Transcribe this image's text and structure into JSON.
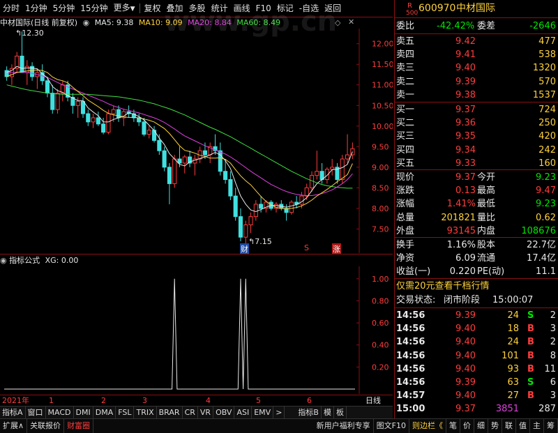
{
  "toolbar": {
    "items": [
      "分时",
      "1分钟",
      "5分钟",
      "15分钟",
      "更多",
      "复权",
      "叠加",
      "多股",
      "统计",
      "画线",
      "F10",
      "标记",
      "-自选",
      "返回"
    ]
  },
  "chart_header": {
    "title": "中材国际(日线 前复权)",
    "ma5": "MA5: 9.38",
    "ma10": "MA10: 9.09",
    "ma20": "MA20: 8.84",
    "ma60": "MA60: 8.49",
    "watermark": "www.gp.cn",
    "high_label": "12.30",
    "low_label": "7.15",
    "mark_cai": "财",
    "mark_s": "S",
    "mark_zhang": "涨",
    "colors": {
      "ma5": "#e8e8e8",
      "ma10": "#ffd23c",
      "ma20": "#e040e0",
      "ma60": "#40e040",
      "up": "#ff3c3c",
      "down": "#40e0e0"
    }
  },
  "chart_data": [
    {
      "type": "candlestick",
      "y_ticks": [
        "12.00",
        "11.50",
        "11.00",
        "10.50",
        "10.00",
        "9.50",
        "9.00",
        "8.50",
        "8.00",
        "7.50"
      ],
      "ylim": [
        7.15,
        12.3
      ],
      "candles": [
        [
          11.35,
          11.45,
          11.1,
          11.2
        ],
        [
          11.2,
          11.5,
          11.0,
          11.4
        ],
        [
          11.4,
          11.8,
          11.3,
          11.7
        ],
        [
          11.7,
          12.3,
          11.5,
          11.3
        ],
        [
          11.3,
          11.6,
          11.0,
          11.45
        ],
        [
          11.45,
          11.55,
          11.1,
          11.2
        ],
        [
          11.2,
          11.4,
          10.9,
          11.3
        ],
        [
          11.3,
          11.5,
          11.0,
          11.1
        ],
        [
          11.1,
          11.2,
          10.7,
          10.8
        ],
        [
          10.8,
          11.0,
          10.3,
          10.4
        ],
        [
          10.4,
          10.9,
          10.3,
          10.8
        ],
        [
          10.8,
          11.1,
          10.6,
          11.0
        ],
        [
          11.0,
          11.1,
          10.6,
          10.7
        ],
        [
          10.7,
          10.8,
          10.3,
          10.5
        ],
        [
          10.5,
          10.7,
          10.2,
          10.6
        ],
        [
          10.6,
          10.7,
          10.2,
          10.3
        ],
        [
          10.3,
          10.4,
          10.0,
          10.1
        ],
        [
          10.1,
          10.3,
          9.95,
          10.2
        ],
        [
          10.2,
          10.35,
          10.0,
          10.05
        ],
        [
          10.05,
          10.2,
          9.8,
          9.85
        ],
        [
          9.85,
          10.4,
          9.8,
          10.3
        ],
        [
          10.3,
          10.5,
          10.1,
          10.4
        ],
        [
          10.4,
          10.5,
          10.1,
          10.2
        ],
        [
          10.2,
          10.4,
          10.0,
          10.35
        ],
        [
          10.35,
          10.5,
          10.2,
          10.3
        ],
        [
          10.3,
          10.4,
          10.1,
          10.2
        ],
        [
          10.2,
          10.3,
          10.0,
          10.1
        ],
        [
          10.1,
          10.2,
          9.75,
          9.8
        ],
        [
          9.8,
          10.0,
          9.7,
          9.9
        ],
        [
          9.9,
          10.0,
          9.6,
          9.65
        ],
        [
          9.65,
          9.8,
          9.3,
          9.4
        ],
        [
          9.4,
          9.5,
          8.9,
          9.0
        ],
        [
          9.0,
          9.1,
          8.1,
          8.6
        ],
        [
          8.6,
          9.3,
          8.5,
          9.2
        ],
        [
          9.2,
          9.5,
          9.0,
          9.1
        ],
        [
          9.1,
          9.3,
          8.85,
          9.25
        ],
        [
          9.25,
          9.4,
          9.0,
          9.1
        ],
        [
          9.1,
          9.3,
          8.8,
          9.2
        ],
        [
          9.2,
          9.5,
          9.1,
          9.4
        ],
        [
          9.4,
          9.6,
          9.2,
          9.3
        ],
        [
          9.3,
          9.6,
          9.1,
          9.5
        ],
        [
          9.5,
          9.8,
          9.3,
          9.4
        ],
        [
          9.4,
          9.6,
          8.8,
          8.9
        ],
        [
          8.9,
          9.2,
          8.6,
          8.7
        ],
        [
          8.7,
          8.9,
          8.2,
          8.3
        ],
        [
          8.3,
          8.5,
          7.7,
          7.8
        ],
        [
          7.8,
          8.0,
          7.2,
          7.3
        ],
        [
          7.3,
          7.7,
          7.15,
          7.6
        ],
        [
          7.6,
          7.9,
          7.4,
          7.8
        ],
        [
          7.8,
          8.2,
          7.7,
          8.1
        ],
        [
          8.1,
          8.3,
          7.9,
          8.0
        ],
        [
          8.0,
          8.2,
          7.9,
          8.15
        ],
        [
          8.15,
          8.2,
          7.95,
          8.0
        ],
        [
          8.0,
          8.15,
          7.9,
          8.1
        ],
        [
          8.1,
          8.2,
          7.95,
          8.0
        ],
        [
          8.0,
          8.1,
          7.7,
          7.9
        ],
        [
          7.9,
          8.2,
          7.85,
          8.15
        ],
        [
          8.15,
          8.3,
          8.0,
          8.1
        ],
        [
          8.1,
          8.4,
          8.0,
          8.3
        ],
        [
          8.3,
          8.6,
          8.2,
          8.5
        ],
        [
          8.5,
          8.9,
          8.4,
          8.8
        ],
        [
          8.8,
          9.4,
          8.7,
          8.9
        ],
        [
          8.9,
          9.1,
          8.6,
          8.7
        ],
        [
          8.7,
          9.0,
          8.6,
          8.95
        ],
        [
          8.95,
          9.2,
          8.8,
          9.0
        ],
        [
          9.0,
          9.1,
          8.6,
          8.7
        ],
        [
          8.7,
          9.3,
          8.6,
          9.2
        ],
        [
          9.2,
          9.8,
          9.1,
          9.3
        ],
        [
          9.3,
          9.6,
          9.2,
          9.45
        ]
      ],
      "ma5": [
        11.3,
        11.35,
        11.45,
        11.4,
        11.41,
        11.41,
        11.39,
        11.27,
        11.17,
        10.96,
        10.86,
        10.82,
        10.74,
        10.68,
        10.62,
        10.62,
        10.44,
        10.34,
        10.25,
        10.1,
        10.1,
        10.16,
        10.2,
        10.24,
        10.32,
        10.29,
        10.23,
        10.15,
        10.02,
        9.89,
        9.71,
        9.55,
        9.33,
        9.2,
        9.07,
        9.03,
        9.13,
        9.17,
        9.21,
        9.25,
        9.3,
        9.36,
        9.3,
        9.16,
        8.97,
        8.62,
        8.3,
        8.1,
        7.96,
        7.92,
        7.97,
        8.03,
        8.07,
        8.07,
        8.05,
        8.03,
        8.06,
        8.09,
        8.16,
        8.26,
        8.43,
        8.6,
        8.7,
        8.8,
        8.94,
        8.95,
        8.99,
        9.07,
        9.38
      ],
      "ma10": [
        11.2,
        11.25,
        11.3,
        11.32,
        11.34,
        11.35,
        11.36,
        11.35,
        11.3,
        11.19,
        11.13,
        11.1,
        11.05,
        10.94,
        10.84,
        10.74,
        10.63,
        10.55,
        10.47,
        10.38,
        10.31,
        10.27,
        10.25,
        10.22,
        10.21,
        10.21,
        10.2,
        10.17,
        10.14,
        10.1,
        10.02,
        9.94,
        9.82,
        9.67,
        9.52,
        9.41,
        9.38,
        9.34,
        9.29,
        9.26,
        9.22,
        9.22,
        9.23,
        9.19,
        9.1,
        8.94,
        8.79,
        8.67,
        8.57,
        8.43,
        8.29,
        8.17,
        8.09,
        8.02,
        8.0,
        7.99,
        8.0,
        8.02,
        8.06,
        8.12,
        8.2,
        8.3,
        8.38,
        8.46,
        8.55,
        8.65,
        8.73,
        8.82,
        9.09
      ],
      "ma20": [
        11.3,
        11.3,
        11.31,
        11.31,
        11.3,
        11.28,
        11.25,
        11.22,
        11.18,
        11.12,
        11.06,
        11.0,
        10.95,
        10.9,
        10.85,
        10.8,
        10.75,
        10.7,
        10.65,
        10.6,
        10.54,
        10.49,
        10.45,
        10.41,
        10.38,
        10.35,
        10.32,
        10.28,
        10.24,
        10.2,
        10.15,
        10.09,
        10.01,
        9.93,
        9.84,
        9.76,
        9.7,
        9.64,
        9.58,
        9.52,
        9.47,
        9.42,
        9.37,
        9.32,
        9.25,
        9.17,
        9.08,
        8.99,
        8.9,
        8.82,
        8.74,
        8.66,
        8.58,
        8.52,
        8.46,
        8.41,
        8.37,
        8.34,
        8.32,
        8.31,
        8.31,
        8.33,
        8.36,
        8.4,
        8.45,
        8.52,
        8.6,
        8.7,
        8.84
      ],
      "ma60": [
        11.0,
        10.97,
        10.94,
        10.91,
        10.88,
        10.86,
        10.84,
        10.82,
        10.8,
        10.79,
        10.78,
        10.77,
        10.77,
        10.77,
        10.77,
        10.77,
        10.77,
        10.76,
        10.75,
        10.74,
        10.73,
        10.72,
        10.71,
        10.69,
        10.67,
        10.65,
        10.63,
        10.6,
        10.57,
        10.54,
        10.5,
        10.46,
        10.42,
        10.37,
        10.32,
        10.27,
        10.21,
        10.15,
        10.09,
        10.03,
        9.97,
        9.92,
        9.86,
        9.8,
        9.74,
        9.67,
        9.6,
        9.53,
        9.46,
        9.39,
        9.32,
        9.25,
        9.18,
        9.11,
        9.04,
        8.97,
        8.9,
        8.84,
        8.78,
        8.72,
        8.67,
        8.62,
        8.58,
        8.55,
        8.53,
        8.51,
        8.5,
        8.49,
        8.49
      ]
    },
    {
      "type": "line",
      "name": "XG",
      "y_ticks": [
        "1.00",
        "0.80",
        "0.60",
        "0.40",
        "0.20"
      ],
      "ylim": [
        0,
        1.1
      ],
      "spikes_at": [
        33,
        46,
        47
      ]
    }
  ],
  "indicator": {
    "label": "指标公式",
    "value": "XG: 0.00"
  },
  "datebar": {
    "year": "2021年",
    "months": [
      "1",
      "2",
      "3",
      "4",
      "5",
      "6"
    ],
    "period": "日线"
  },
  "tabs": [
    "指标A",
    "窗口",
    "MACD",
    "DMI",
    "DMA",
    "FSL",
    "TRIX",
    "BRAR",
    "CR",
    "VR",
    "OBV",
    "ASI",
    "EMV",
    ">",
    "指标B",
    "模",
    "板"
  ],
  "statusbar": {
    "items": [
      "扩展∧",
      "关联报价",
      "财富圈"
    ],
    "right": [
      "新用户福利专享",
      "图文F10",
      "则边栏《",
      "笔",
      "价",
      "细",
      "势",
      "联",
      "值",
      "主",
      "筹"
    ]
  },
  "quote": {
    "r_label": "R",
    "code_small": "500",
    "code": "600970",
    "name": "中材国际",
    "weibi_label": "委比",
    "weibi": "-42.42%",
    "weicha_label": "委差",
    "weicha": "-2646",
    "asks": [
      {
        "label": "卖五",
        "price": "9.42",
        "vol": "477"
      },
      {
        "label": "卖四",
        "price": "9.41",
        "vol": "538"
      },
      {
        "label": "卖三",
        "price": "9.40",
        "vol": "1320"
      },
      {
        "label": "卖二",
        "price": "9.39",
        "vol": "570"
      },
      {
        "label": "卖一",
        "price": "9.38",
        "vol": "1537"
      }
    ],
    "bids": [
      {
        "label": "买一",
        "price": "9.37",
        "vol": "724"
      },
      {
        "label": "买二",
        "price": "9.36",
        "vol": "250"
      },
      {
        "label": "买三",
        "price": "9.35",
        "vol": "420"
      },
      {
        "label": "买四",
        "price": "9.34",
        "vol": "242"
      },
      {
        "label": "买五",
        "price": "9.33",
        "vol": "160"
      }
    ],
    "stats": [
      {
        "l1": "现价",
        "v1": "9.37",
        "l2": "今开",
        "v2": "9.23",
        "c1": "red",
        "c2": "green"
      },
      {
        "l1": "涨跌",
        "v1": "0.13",
        "l2": "最高",
        "v2": "9.47",
        "c1": "red",
        "c2": "red"
      },
      {
        "l1": "涨幅",
        "v1": "1.41%",
        "l2": "最低",
        "v2": "9.23",
        "c1": "red",
        "c2": "green"
      },
      {
        "l1": "总量",
        "v1": "201821",
        "l2": "量比",
        "v2": "0.62",
        "c1": "yellow",
        "c2": "yellow"
      },
      {
        "l1": "外盘",
        "v1": "93145",
        "l2": "内盘",
        "v2": "108676",
        "c1": "red",
        "c2": "green"
      }
    ],
    "stats2": [
      {
        "l1": "换手",
        "v1": "1.16%",
        "l2": "股本",
        "v2": "22.7亿"
      },
      {
        "l1": "净资",
        "v1": "6.09",
        "l2": "流通",
        "v2": "17.4亿"
      },
      {
        "l1": "收益(一)",
        "v1": "0.220",
        "l2": "PE(动)",
        "v2": "11.1"
      }
    ],
    "promo": "仅需20元查看千档行情",
    "trade_state_label": "交易状态:",
    "trade_state": "闭市阶段",
    "trade_time": "15:00:07",
    "ticks": [
      {
        "t": "14:56",
        "p": "9.39",
        "v": "24",
        "d": "S",
        "n": "2"
      },
      {
        "t": "14:56",
        "p": "9.40",
        "v": "18",
        "d": "B",
        "n": "3"
      },
      {
        "t": "14:56",
        "p": "9.40",
        "v": "24",
        "d": "B",
        "n": "2"
      },
      {
        "t": "14:56",
        "p": "9.40",
        "v": "101",
        "d": "B",
        "n": "8"
      },
      {
        "t": "14:56",
        "p": "9.40",
        "v": "93",
        "d": "B",
        "n": "11"
      },
      {
        "t": "14:56",
        "p": "9.39",
        "v": "63",
        "d": "S",
        "n": "6"
      },
      {
        "t": "14:57",
        "p": "9.40",
        "v": "27",
        "d": "B",
        "n": "3"
      },
      {
        "t": "15:00",
        "p": "9.37",
        "v": "3851",
        "d": "",
        "n": "287"
      }
    ]
  }
}
